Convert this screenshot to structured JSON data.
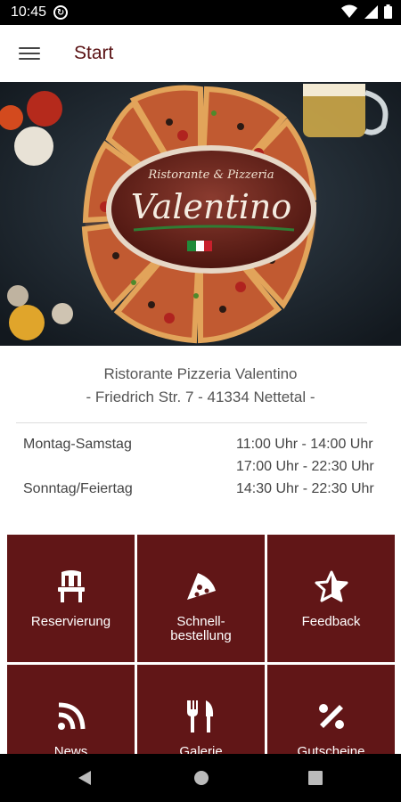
{
  "status": {
    "time": "10:45"
  },
  "appbar": {
    "title": "Start"
  },
  "hero": {
    "logo_top": "Ristorante & Pizzeria",
    "logo_main": "Valentino"
  },
  "restaurant": {
    "name": "Ristorante Pizzeria Valentino",
    "address": "- Friedrich Str. 7 - 41334 Nettetal -"
  },
  "hours": [
    {
      "day": "Montag-Samstag",
      "time": "11:00 Uhr - 14:00 Uhr"
    },
    {
      "day": "",
      "time": "17:00 Uhr - 22:30 Uhr"
    },
    {
      "day": "Sonntag/Feiertag",
      "time": "14:30 Uhr - 22:30 Uhr"
    }
  ],
  "tiles": [
    {
      "label": "Reservierung",
      "icon": "chair-icon"
    },
    {
      "label": "Schnell-\nbestellung",
      "icon": "pizza-slice-icon"
    },
    {
      "label": "Feedback",
      "icon": "star-icon"
    },
    {
      "label": "News",
      "icon": "rss-icon"
    },
    {
      "label": "Galerie",
      "icon": "fork-knife-icon"
    },
    {
      "label": "Gutscheine",
      "icon": "percent-icon"
    }
  ],
  "colors": {
    "accent": "#611617",
    "title": "#5a1214"
  }
}
